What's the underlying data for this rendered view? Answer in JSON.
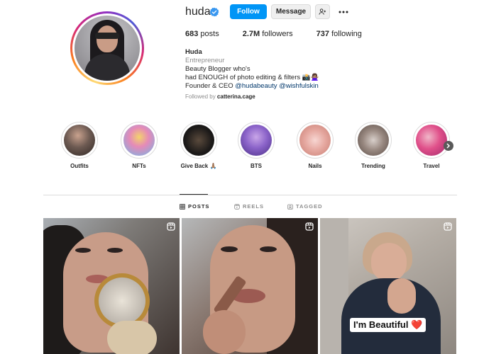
{
  "profile": {
    "username": "huda",
    "follow_label": "Follow",
    "message_label": "Message",
    "stats": {
      "posts_count": "683",
      "posts_label": "posts",
      "followers_count": "2.7M",
      "followers_label": "followers",
      "following_count": "737",
      "following_label": "following"
    },
    "bio": {
      "name": "Huda",
      "category": "Entrepreneur",
      "line1": "Beauty Blogger who's",
      "line2": "had ENOUGH of photo editing & filters 📸🙅🏽‍♀️",
      "line3_prefix": "Founder & CEO",
      "tag1": "@hudabeauty",
      "tag2": "@wishfulskin"
    },
    "followed_by_prefix": "Followed by",
    "followed_by_user": "catterina.cage"
  },
  "highlights": [
    {
      "label": "Outfits"
    },
    {
      "label": "NFTs"
    },
    {
      "label": "Give Back 🙏🏽"
    },
    {
      "label": "BTS"
    },
    {
      "label": "Nails"
    },
    {
      "label": "Trending"
    },
    {
      "label": "Travel"
    }
  ],
  "tabs": [
    {
      "label": "POSTS",
      "active": true
    },
    {
      "label": "REELS",
      "active": false
    },
    {
      "label": "TAGGED",
      "active": false
    }
  ],
  "posts": [
    {
      "type": "reel"
    },
    {
      "type": "reel"
    },
    {
      "type": "reel",
      "caption": "I'm Beautiful ❤️"
    }
  ],
  "colors": {
    "accent": "#0095f6",
    "verified": "#3897f0",
    "link": "#00376b",
    "muted": "#8e8e8e"
  }
}
